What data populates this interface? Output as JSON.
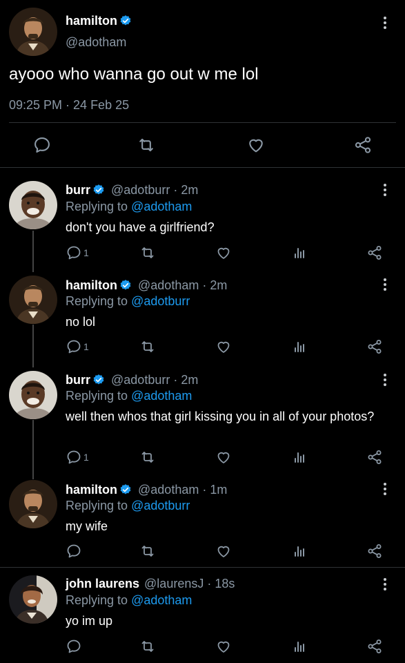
{
  "main_tweet": {
    "name": "hamilton",
    "handle": "@adotham",
    "text": "ayooo who wanna go out w me lol",
    "timestamp": "09:25 PM · 24 Feb 25"
  },
  "replies": [
    {
      "name": "burr",
      "handle": "@adotburr",
      "time": "2m",
      "replying_label": "Replying to",
      "replying_to": "@adotham",
      "text": "don't you have a girlfriend?",
      "reply_count": "1"
    },
    {
      "name": "hamilton",
      "handle": "@adotham",
      "time": "2m",
      "replying_label": "Replying to",
      "replying_to": "@adotburr",
      "text": "no lol",
      "reply_count": "1"
    },
    {
      "name": "burr",
      "handle": "@adotburr",
      "time": "2m",
      "replying_label": "Replying to",
      "replying_to": "@adotham",
      "text": "well then whos that girl kissing you in all of your photos?",
      "reply_count": "1"
    },
    {
      "name": "hamilton",
      "handle": "@adotham",
      "time": "1m",
      "replying_label": "Replying to",
      "replying_to": "@adotburr",
      "text": "my wife",
      "reply_count": ""
    },
    {
      "name": "john laurens",
      "handle": "@laurensJ",
      "time": "18s",
      "replying_label": "Replying to",
      "replying_to": "@adotham",
      "text": "yo im up",
      "reply_count": ""
    }
  ],
  "colors": {
    "background": "#000000",
    "accent": "#1d9bf0",
    "muted": "#8b98a5",
    "divider": "#2f3336"
  },
  "icons": [
    "verified-badge-icon",
    "reply-icon",
    "retweet-icon",
    "like-icon",
    "views-icon",
    "share-icon",
    "more-icon"
  ]
}
